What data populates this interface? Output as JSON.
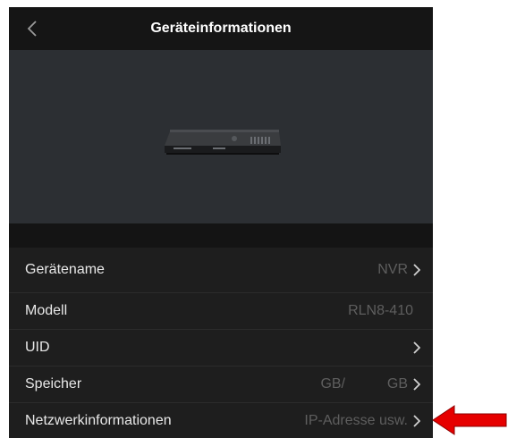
{
  "header": {
    "title": "Geräteinformationen",
    "back_icon": "chevron-left-icon"
  },
  "hero": {
    "image": "nvr-device-image"
  },
  "rows": [
    {
      "label": "Gerätename",
      "value": "NVR",
      "chevron": true
    },
    {
      "label": "Modell",
      "value": "RLN8-410",
      "chevron": false
    },
    {
      "label": "UID",
      "value": "",
      "chevron": true
    },
    {
      "label": "Speicher",
      "value_a": "GB/",
      "value_b": "GB",
      "chevron": true
    },
    {
      "label": "Netzwerkinformationen",
      "value": "IP-Adresse usw.",
      "chevron": true
    }
  ],
  "annotation": {
    "arrow_color": "#e60000"
  },
  "colors": {
    "background": "#1e1e1e",
    "topbar": "#151515",
    "hero": "#2c2f33",
    "label": "#e8e8e8",
    "value": "#5e5e5e"
  }
}
